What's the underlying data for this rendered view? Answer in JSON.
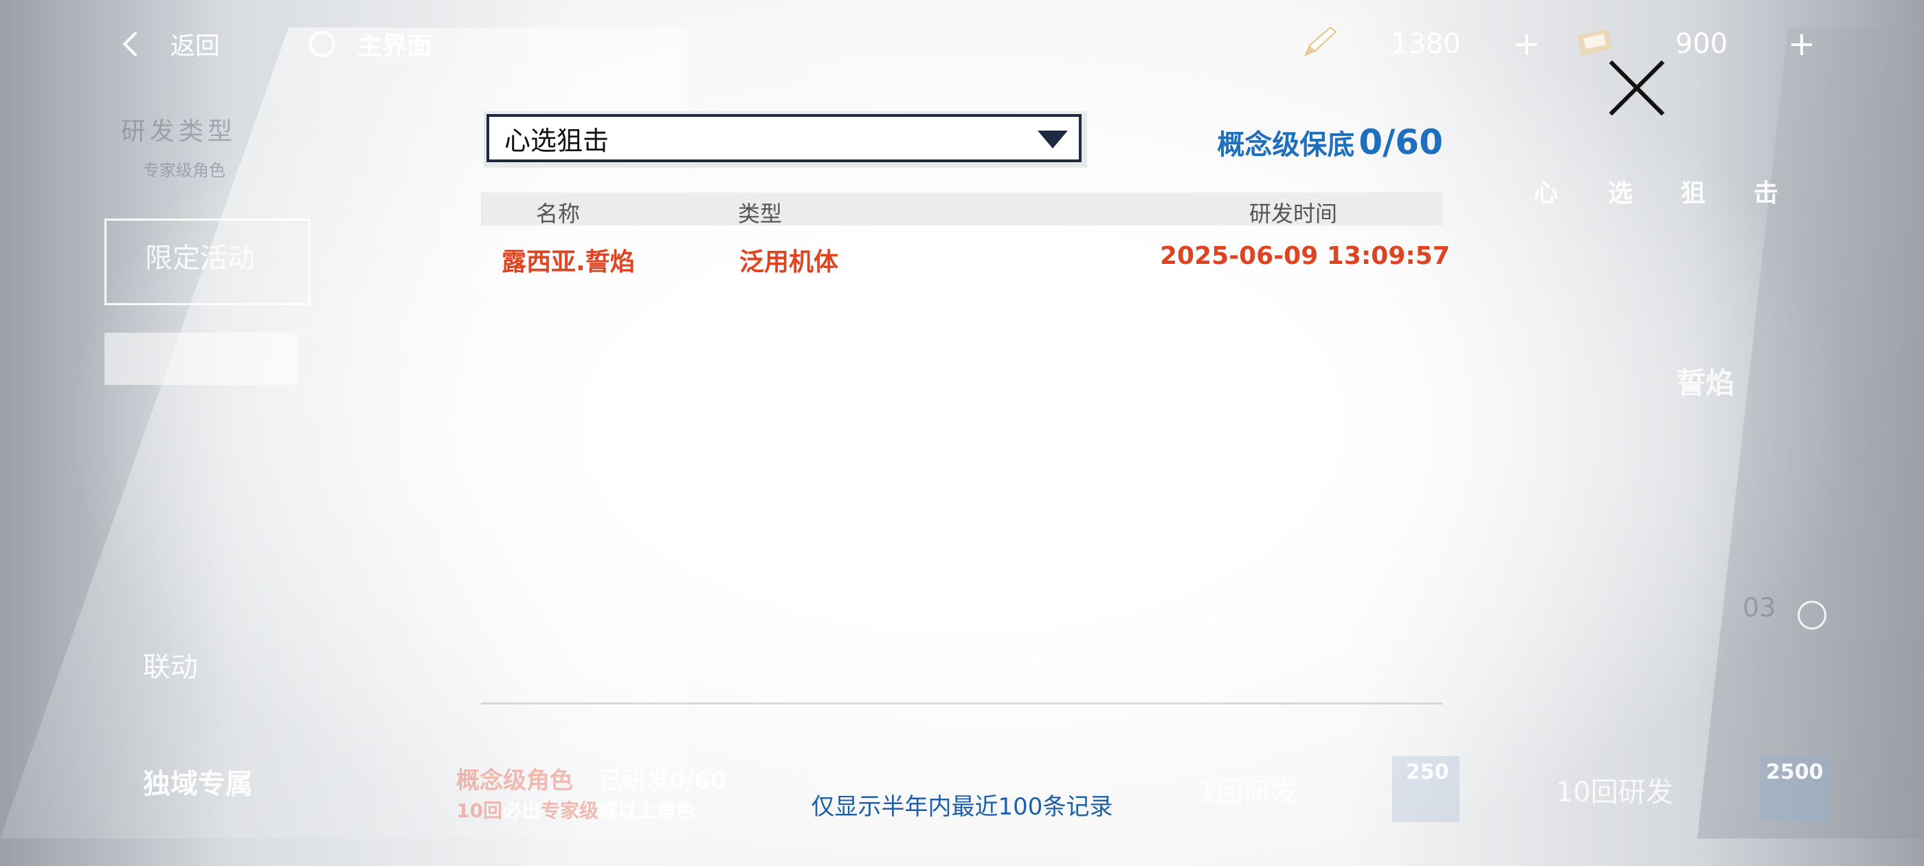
{
  "topbar": {
    "back_label": "返回",
    "home_label": "主界面",
    "currency1_value": "1380",
    "currency2_value": "900",
    "plus_symbol": "+"
  },
  "background": {
    "section_title": "研发类型",
    "section_subtitle": "专家级角色",
    "tab_limited": "限定活动",
    "tab_collab": "联动",
    "tab_exclusive": "独域专属",
    "banner_chars": [
      "心",
      "选",
      "狙",
      "击"
    ],
    "banner_name": "誓焰",
    "concept_label": "概念级角色",
    "researched_label": "已研发0/60",
    "ten_pull_note_red1": "10回",
    "ten_pull_note_white1": "必出",
    "ten_pull_note_red2": "专家级",
    "ten_pull_note_white2": "或以上角色",
    "single_pull_label": "1回研发",
    "single_pull_cost": "250",
    "ten_pull_label": "10回研发",
    "ten_pull_cost": "2500",
    "timer_fragment": "03"
  },
  "modal": {
    "dropdown_value": "心选狙击",
    "pity_label": "概念级保底",
    "pity_value": "0/60",
    "columns": {
      "name": "名称",
      "type": "类型",
      "time": "研发时间"
    },
    "rows": [
      {
        "name": "露西亚.誓焰",
        "type": "泛用机体",
        "time": "2025-06-09 13:09:57"
      }
    ],
    "footnote": "仅显示半年内最近100条记录"
  },
  "colors": {
    "accent_blue": "#1f6fbf",
    "record_red": "#e0431f",
    "dropdown_border": "#1d2a3f"
  }
}
